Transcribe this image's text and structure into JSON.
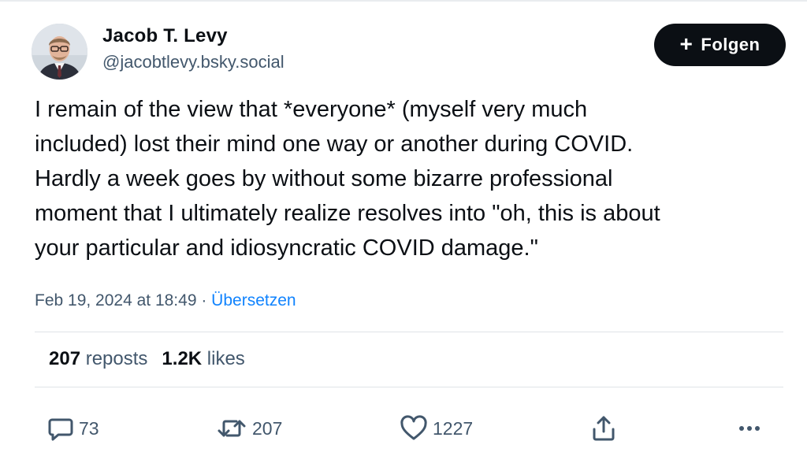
{
  "author": {
    "display_name": "Jacob T. Levy",
    "handle": "@jacobtlevy.bsky.social",
    "avatar_icon": "avatar-photo"
  },
  "follow_button": {
    "icon": "plus-icon",
    "label": "Folgen"
  },
  "post": {
    "text": "I remain of the view that *everyone* (myself very much\nincluded) lost their mind one way or another during COVID.\nHardly a week goes by without some bizarre professional\nmoment that I ultimately realize resolves into \"oh, this is about\nyour particular and idiosyncratic COVID damage.\""
  },
  "meta": {
    "timestamp": "Feb 19, 2024 at 18:49",
    "separator": " · ",
    "translate_label": "Übersetzen"
  },
  "stats": {
    "reposts_count": "207",
    "reposts_label": "reposts",
    "likes_count": "1.2K",
    "likes_label": "likes"
  },
  "actions": {
    "reply_count": "73",
    "repost_count": "207",
    "like_count": "1227"
  },
  "colors": {
    "text": "#0b0f14",
    "secondary": "#42576c",
    "link": "#1083fe",
    "button_bg": "#0b0f14"
  }
}
